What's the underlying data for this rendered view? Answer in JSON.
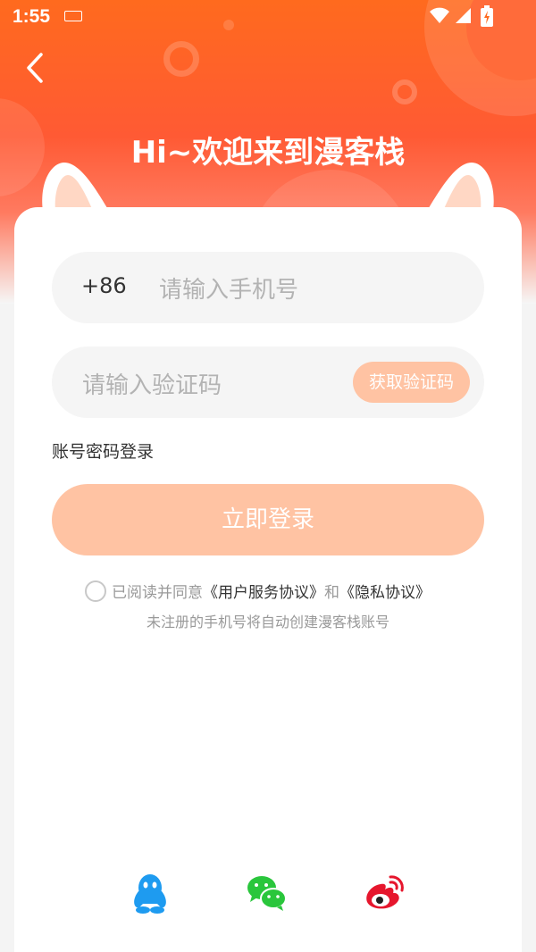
{
  "status_bar": {
    "time": "1:55"
  },
  "header": {
    "title": "Hi~欢迎来到漫客栈"
  },
  "phone_field": {
    "country_code": "+86",
    "placeholder": "请输入手机号"
  },
  "code_field": {
    "placeholder": "请输入验证码",
    "get_code_label": "获取验证码"
  },
  "password_login_link": "账号密码登录",
  "login_button": "立即登录",
  "agreement": {
    "prefix": "已阅读并同意",
    "user_agreement": "《用户服务协议》",
    "and": "和",
    "privacy": "《隐私协议》"
  },
  "note": "未注册的手机号将自动创建漫客栈账号",
  "social": [
    {
      "icon": "qq-icon",
      "color": "#1e9bf0"
    },
    {
      "icon": "wechat-icon",
      "color": "#2ac63c"
    },
    {
      "icon": "weibo-icon",
      "color": "#e6162d"
    }
  ],
  "colors": {
    "accent": "#ff5f2a",
    "button_disabled": "#ffc3a3"
  }
}
